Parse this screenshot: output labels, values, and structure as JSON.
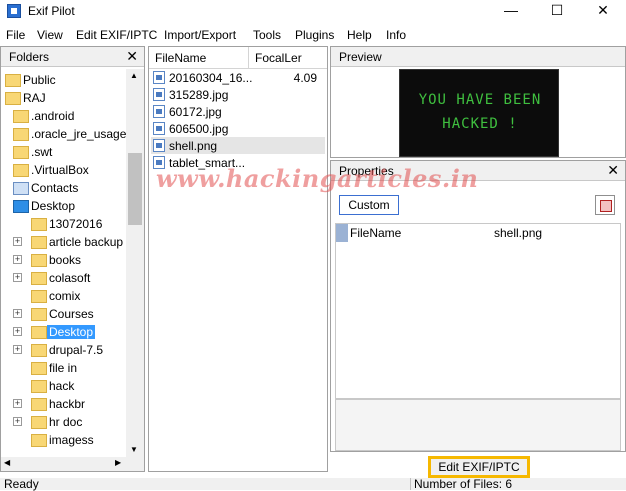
{
  "window": {
    "title": "Exif Pilot"
  },
  "menu": [
    "File",
    "View",
    "Edit EXIF/IPTC",
    "Import/Export",
    "Tools",
    "Plugins",
    "Help",
    "Info"
  ],
  "folders": {
    "label": "Folders",
    "items": [
      {
        "label": "Public",
        "level": 0,
        "expander": false
      },
      {
        "label": "RAJ",
        "level": 0,
        "expander": false
      },
      {
        "label": ".android",
        "level": 1,
        "expander": false
      },
      {
        "label": ".oracle_jre_usage",
        "level": 1,
        "expander": false
      },
      {
        "label": ".swt",
        "level": 1,
        "expander": false
      },
      {
        "label": ".VirtualBox",
        "level": 1,
        "expander": false
      },
      {
        "label": "Contacts",
        "level": 1,
        "expander": false,
        "icon": "contacts"
      },
      {
        "label": "Desktop",
        "level": 1,
        "expander": false,
        "icon": "desktop"
      },
      {
        "label": "13072016",
        "level": 2,
        "expander": false
      },
      {
        "label": "article backup",
        "level": 2,
        "expander": true
      },
      {
        "label": "books",
        "level": 2,
        "expander": true
      },
      {
        "label": "colasoft",
        "level": 2,
        "expander": true
      },
      {
        "label": "comix",
        "level": 2,
        "expander": false
      },
      {
        "label": "Courses",
        "level": 2,
        "expander": true
      },
      {
        "label": "Desktop",
        "level": 2,
        "expander": true,
        "selected": true
      },
      {
        "label": "drupal-7.5",
        "level": 2,
        "expander": true
      },
      {
        "label": "file in",
        "level": 2,
        "expander": false
      },
      {
        "label": "hack",
        "level": 2,
        "expander": false
      },
      {
        "label": "hackbr",
        "level": 2,
        "expander": true
      },
      {
        "label": "hr doc",
        "level": 2,
        "expander": true
      },
      {
        "label": "imagess",
        "level": 2,
        "expander": false
      }
    ]
  },
  "files": {
    "col_filename": "FileName",
    "col_focal": "FocalLer",
    "rows": [
      {
        "name": "20160304_16...",
        "focal": "4.09"
      },
      {
        "name": "315289.jpg",
        "focal": ""
      },
      {
        "name": "60172.jpg",
        "focal": ""
      },
      {
        "name": "606500.jpg",
        "focal": ""
      },
      {
        "name": "shell.png",
        "focal": "",
        "selected": true
      },
      {
        "name": "tablet_smart...",
        "focal": ""
      }
    ]
  },
  "preview": {
    "label": "Preview",
    "line1": "YOU HAVE BEEN",
    "line2": "HACKED !"
  },
  "properties": {
    "label": "Properties",
    "custom_button": "Custom",
    "row_key": "FileName",
    "row_value": "shell.png"
  },
  "watermark": "www.hackingarticles.in",
  "edit_button": "Edit EXIF/IPTC",
  "status": {
    "left": "Ready",
    "right": "Number of Files: 6"
  },
  "icons": {
    "app": "exif-pilot-app-icon",
    "folder": "folder-icon",
    "file": "image-file-icon",
    "properties_edit": "properties-edit-icon"
  },
  "colors": {
    "selection": "#3399ff",
    "edit_button_outline": "#f6b800",
    "hacked_text": "#3fbf3f"
  }
}
